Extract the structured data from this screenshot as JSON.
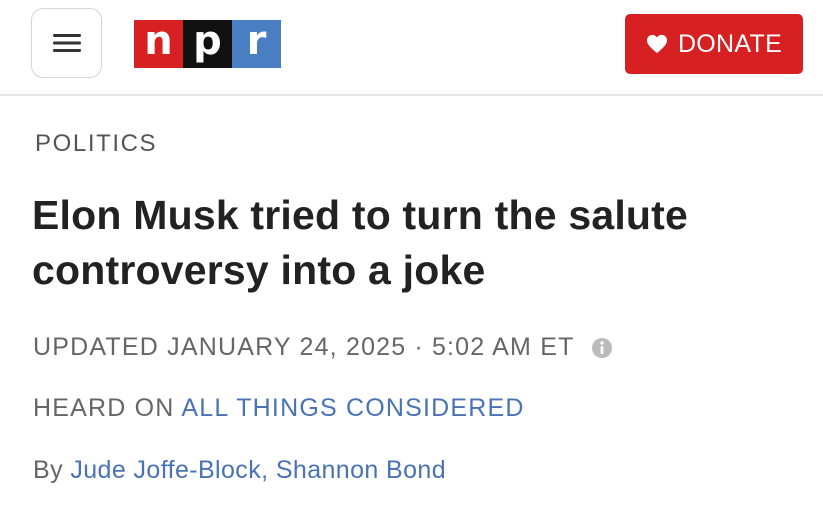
{
  "header": {
    "menu_icon": "hamburger-menu-icon",
    "logo": {
      "letters": [
        "n",
        "p",
        "r"
      ],
      "colors": [
        "#d62021",
        "#111111",
        "#4a7ec2"
      ]
    },
    "donate": {
      "label": "DONATE",
      "icon": "heart-icon",
      "color": "#d62021"
    }
  },
  "article": {
    "section": "POLITICS",
    "headline": "Elon Musk tried to turn the salute controversy into a joke",
    "updated_label": "UPDATED JANUARY 24, 2025",
    "separator": "·",
    "time": "5:02 AM ET",
    "info_icon": "info-icon",
    "heard_on_label": "HEARD ON",
    "show_name": "ALL THINGS CONSIDERED",
    "by_label": "By",
    "authors": [
      "Jude Joffe-Block",
      "Shannon Bond"
    ],
    "author_separator": ", "
  }
}
